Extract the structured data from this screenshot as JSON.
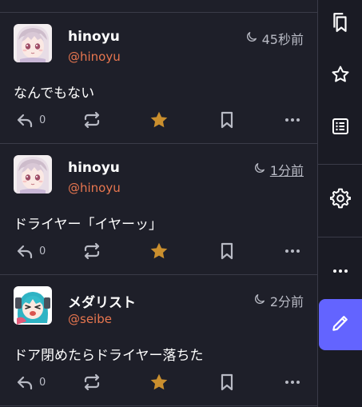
{
  "posts": [
    {
      "display_name": "hinoyu",
      "handle": "@hinoyu",
      "time": "45秒前",
      "time_linked": false,
      "content": "なんでもない",
      "reply_count": "0",
      "avatar": "anime-girl-pink-hair"
    },
    {
      "display_name": "hinoyu",
      "handle": "@hinoyu",
      "time": "1分前",
      "time_linked": true,
      "content": "ドライヤー「イヤーッ」",
      "reply_count": "0",
      "avatar": "anime-girl-pink-hair"
    },
    {
      "display_name": "メダリスト",
      "handle": "@seibe",
      "time": "2分前",
      "time_linked": false,
      "content": "ドア閉めたらドライヤー落ちた",
      "reply_count": "0",
      "avatar": "anime-girl-teal-hair"
    }
  ],
  "sidebar": {
    "items": [
      "bookmarks-icon",
      "star-icon",
      "list-icon",
      "gear-icon",
      "more-icon"
    ],
    "compose": "pencil-icon"
  },
  "colors": {
    "background": "#1e1f29",
    "handle": "#e8764f",
    "favourite": "#ca8f2e",
    "muted": "#b8bac4",
    "compose": "#6364ff"
  }
}
